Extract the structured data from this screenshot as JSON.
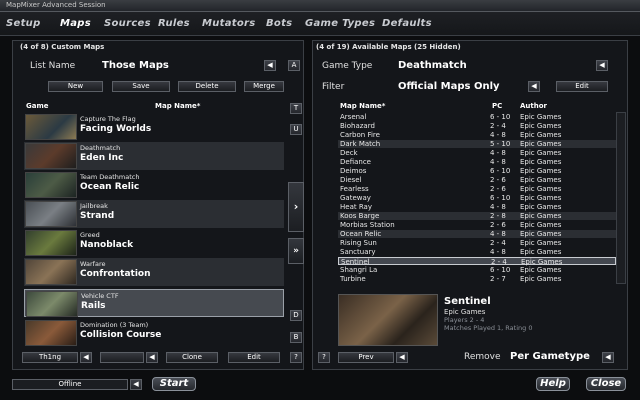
{
  "window": {
    "title": "MapMixer Advanced Session"
  },
  "tabs": [
    "Setup",
    "Maps",
    "Sources",
    "Rules",
    "Mutators",
    "Bots",
    "Game Types",
    "Defaults"
  ],
  "left": {
    "header": "(4 of 8) Custom Maps",
    "list_name_label": "List Name",
    "list_name_value": "Those Maps",
    "a_button": "A",
    "buttons": [
      "New",
      "Save",
      "Delete",
      "Merge"
    ],
    "col_game": "Game",
    "col_map": "Map Name*",
    "maps": [
      {
        "type": "Capture The Flag",
        "name": "Facing Worlds"
      },
      {
        "type": "Deathmatch",
        "name": "Eden Inc"
      },
      {
        "type": "Team Deathmatch",
        "name": "Ocean Relic"
      },
      {
        "type": "Jailbreak",
        "name": "Strand"
      },
      {
        "type": "Greed",
        "name": "Nanoblack"
      },
      {
        "type": "Warfare",
        "name": "Confrontation"
      },
      {
        "type": "Vehicle CTF",
        "name": "Rails"
      },
      {
        "type": "Domination (3 Team)",
        "name": "Collision Course"
      }
    ],
    "side_buttons": [
      "T",
      "U",
      "D",
      "B"
    ],
    "bottom": {
      "thing": "Th1ng",
      "clone": "Clone",
      "edit": "Edit",
      "help": "?"
    }
  },
  "right": {
    "header": "(4 of 19) Available Maps (25 Hidden)",
    "game_type_label": "Game Type",
    "game_type_value": "Deathmatch",
    "filter_label": "Filter",
    "filter_value": "Official Maps Only",
    "edit_button": "Edit",
    "col_map": "Map Name*",
    "col_pc": "PC",
    "col_author": "Author",
    "maps": [
      {
        "name": "Arsenal",
        "pc": "6 - 10",
        "author": "Epic Games"
      },
      {
        "name": "Biohazard",
        "pc": "2 - 4",
        "author": "Epic Games"
      },
      {
        "name": "Carbon Fire",
        "pc": "4 - 8",
        "author": "Epic Games"
      },
      {
        "name": "Dark Match",
        "pc": "5 - 10",
        "author": "Epic Games"
      },
      {
        "name": "Deck",
        "pc": "4 - 8",
        "author": "Epic Games"
      },
      {
        "name": "Defiance",
        "pc": "4 - 8",
        "author": "Epic Games"
      },
      {
        "name": "Deimos",
        "pc": "6 - 10",
        "author": "Epic Games"
      },
      {
        "name": "Diesel",
        "pc": "2 - 6",
        "author": "Epic Games"
      },
      {
        "name": "Fearless",
        "pc": "2 - 6",
        "author": "Epic Games"
      },
      {
        "name": "Gateway",
        "pc": "6 - 10",
        "author": "Epic Games"
      },
      {
        "name": "Heat Ray",
        "pc": "4 - 8",
        "author": "Epic Games"
      },
      {
        "name": "Koos Barge",
        "pc": "2 - 8",
        "author": "Epic Games"
      },
      {
        "name": "Morbias Station",
        "pc": "2 - 6",
        "author": "Epic Games"
      },
      {
        "name": "Ocean Relic",
        "pc": "4 - 8",
        "author": "Epic Games"
      },
      {
        "name": "Rising Sun",
        "pc": "2 - 4",
        "author": "Epic Games"
      },
      {
        "name": "Sanctuary",
        "pc": "4 - 8",
        "author": "Epic Games"
      },
      {
        "name": "Sentinel",
        "pc": "2 - 4",
        "author": "Epic Games"
      },
      {
        "name": "Shangri La",
        "pc": "6 - 10",
        "author": "Epic Games"
      },
      {
        "name": "Turbine",
        "pc": "2 - 7",
        "author": "Epic Games"
      }
    ],
    "preview": {
      "name": "Sentinel",
      "author": "Epic Games",
      "players": "Players 2 - 4",
      "stats": "Matches Played 1,  Rating 0"
    },
    "help_button": "?",
    "prev_button": "Prev",
    "remove_label": "Remove",
    "remove_value": "Per Gametype"
  },
  "footer": {
    "status": "Offline",
    "start": "Start",
    "help": "Help",
    "close": "Close"
  }
}
